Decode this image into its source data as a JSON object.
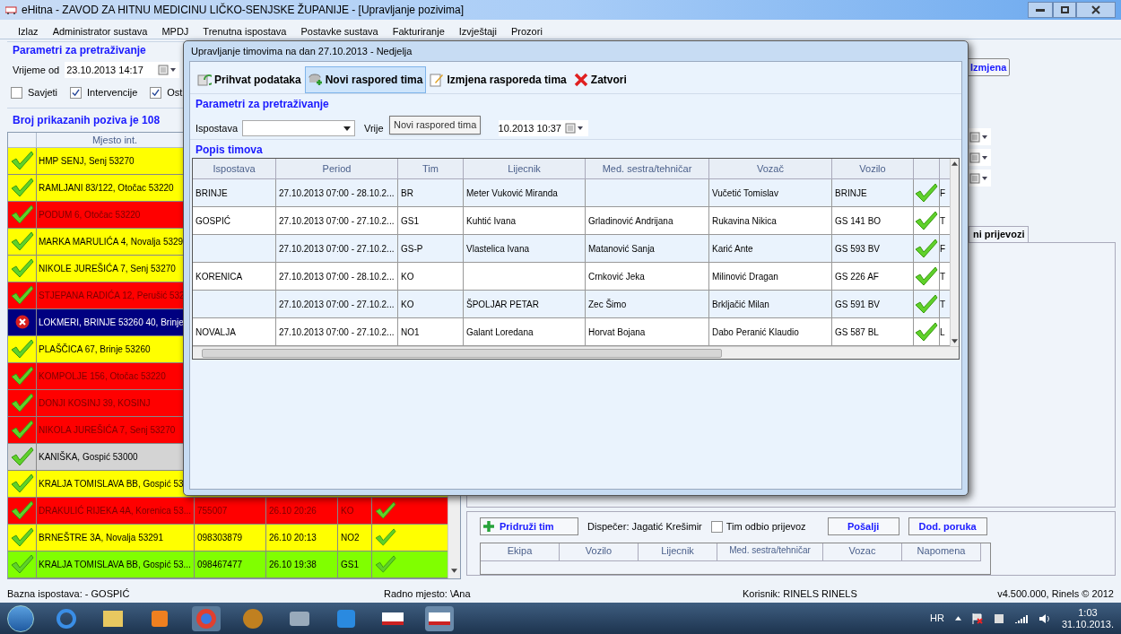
{
  "window": {
    "title": "eHitna - ZAVOD ZA HITNU MEDICINU LIČKO-SENJSKE ŽUPANIJE - [Upravljanje pozivima]"
  },
  "menu": [
    "Izlaz",
    "Administrator sustava",
    "MPDJ",
    "Trenutna ispostava",
    "Postavke sustava",
    "Fakturiranje",
    "Izvještaji",
    "Prozori"
  ],
  "search": {
    "title": "Parametri za pretraživanje",
    "from_label": "Vrijeme od",
    "from_value": "23.10.2013 14:17",
    "filters": [
      {
        "label": "Savjeti",
        "checked": false
      },
      {
        "label": "Intervencije",
        "checked": true
      },
      {
        "label": "Ost",
        "checked": true
      }
    ]
  },
  "calls": {
    "count_text": "Broj prikazanih poziva je 108",
    "columns": [
      "Mjesto int."
    ],
    "rows": [
      {
        "kind": "ok",
        "color": "#ffff00",
        "place": "HMP SENJ, Senj 53270"
      },
      {
        "kind": "ok",
        "color": "#ffff00",
        "place": "RAMLJANI 83/122, Otočac 53220"
      },
      {
        "kind": "ok",
        "color": "#ff0000",
        "place": "PODUM 6, Otočac 53220"
      },
      {
        "kind": "ok",
        "color": "#ffff00",
        "place": "MARKA MARULIĆA 4, Novalja 5329"
      },
      {
        "kind": "ok",
        "color": "#ffff00",
        "place": "NIKOLE JUREŠIĆA 7, Senj 53270"
      },
      {
        "kind": "ok",
        "color": "#ff0000",
        "place": "STJEPANA RADIĆA 12, Perušić 532"
      },
      {
        "kind": "cancelled",
        "color": "#000080",
        "place": "LOKMERI, BRINJE 53260 40, Brinje"
      },
      {
        "kind": "ok",
        "color": "#ffff00",
        "place": "PLAŠČICA 67, Brinje 53260"
      },
      {
        "kind": "ok",
        "color": "#ff0000",
        "place": "KOMPOLJE 156, Otočac 53220"
      },
      {
        "kind": "ok",
        "color": "#ff0000",
        "place": "DONJI KOSINJ 39, KOSINJ"
      },
      {
        "kind": "ok",
        "color": "#ff0000",
        "place": "NIKOLA JUREŠIĆA 7, Senj 53270"
      },
      {
        "kind": "ok",
        "color": "#d4d4d4",
        "place": "KANIŠKA, Gospić 53000"
      },
      {
        "kind": "ok",
        "color": "#ffff00",
        "place": "KRALJA TOMISLAVA BB, Gospić 53"
      },
      {
        "kind": "ok",
        "color": "#ff0000",
        "place": "DRAKULIĆ RIJEKA 4A, Korenica 53...",
        "cells": [
          "755007",
          "26.10 20:26",
          "KO"
        ],
        "confirmed": true
      },
      {
        "kind": "ok",
        "color": "#ffff00",
        "place": "BRNEŠTRE 3A, Novalja 53291",
        "cells": [
          "098303879",
          "26.10 20:13",
          "NO2"
        ],
        "confirmed": true
      },
      {
        "kind": "ok",
        "color": "#80ff00",
        "place": "KRALJA TOMISLAVA BB, Gospić 53...",
        "cells": [
          "098467477",
          "26.10 19:38",
          "GS1"
        ],
        "confirmed": true
      }
    ]
  },
  "right": {
    "edit_button": "Izmjena",
    "tabs": [
      {
        "label": "ni prijevozi",
        "selected": true
      }
    ],
    "join_button": "Pridruži tim",
    "dispatcher": "Dispečer: Jagatić Krešimir",
    "refused": {
      "label": "Tim odbio prijevoz",
      "checked": false
    },
    "send_button": "Pošalji",
    "message_button": "Dod. poruka",
    "columns": [
      "Ekipa",
      "Vozilo",
      "Lijecnik",
      "Med. sestra/tehničar",
      "Vozac",
      "Napomena"
    ]
  },
  "dialog": {
    "title": "Upravljanje timovima na dan 27.10.2013 - Nedjelja",
    "toolbar": [
      {
        "kind": "accept",
        "label": "Prihvat podataka",
        "highlighted": false
      },
      {
        "kind": "new",
        "label": "Novi raspored tima",
        "highlighted": true
      },
      {
        "kind": "edit",
        "label": "Izmjena rasporeda tima",
        "highlighted": false
      },
      {
        "kind": "close",
        "label": "Zatvori",
        "highlighted": false
      }
    ],
    "tooltip": "Novi raspored tima",
    "params_title": "Parametri za pretraživanje",
    "station_label": "Ispostava",
    "time_label": "Vrije",
    "time_value": "10.2013 10:37",
    "teams_title": "Popis timova",
    "columns": [
      "Ispostava",
      "Period",
      "Tim",
      "Lijecnik",
      "Med. sestra/tehničar",
      "Vozač",
      "Vozilo"
    ],
    "rows": [
      {
        "cells": [
          "BRINJE",
          "27.10.2013 07:00 - 28.10.2...",
          "BR",
          "Meter Vuković Miranda",
          "",
          "Vučetić Tomislav",
          "BRINJE"
        ],
        "confirmed": true,
        "column_9": "F"
      },
      {
        "cells": [
          "GOSPIĆ",
          "27.10.2013 07:00 - 27.10.2...",
          "GS1",
          "Kuhtić Ivana",
          "Grladinović Andrijana",
          "Rukavina Nikica",
          "GS 141 BO"
        ],
        "confirmed": true,
        "column_9": "T"
      },
      {
        "cells": [
          "",
          "27.10.2013 07:00 - 27.10.2...",
          "GS-P",
          "Vlastelica Ivana",
          "Matanović Sanja",
          "Karić Ante",
          "GS 593 BV"
        ],
        "confirmed": true,
        "column_9": "F"
      },
      {
        "cells": [
          "KORENICA",
          "27.10.2013 07:00 - 28.10.2...",
          "KO",
          "",
          "Crnković Jeka",
          "Milinović Dragan",
          "GS 226 AF"
        ],
        "confirmed": true,
        "column_9": "T"
      },
      {
        "cells": [
          "",
          "27.10.2013 07:00 - 27.10.2...",
          "KO",
          "ŠPOLJAR PETAR",
          "Zec Šimo",
          "Brkljačić Milan",
          "GS 591 BV"
        ],
        "confirmed": true,
        "column_9": "T"
      },
      {
        "cells": [
          "NOVALJA",
          "27.10.2013 07:00 - 27.10.2...",
          "NO1",
          "Galant Loredana",
          "Horvat Bojana",
          "Dabo Peranić Klaudio",
          "GS 587 BL"
        ],
        "confirmed": true,
        "column_9": "L"
      }
    ]
  },
  "status_bar": [
    "Bazna ispostava:  - GOSPIĆ",
    "Radno mjesto: \\Ana",
    "Korisnik: RINELS RINELS",
    "v4.500.000, Rinels © 2012"
  ],
  "taskbar": {
    "language": "HR",
    "time": "1:03",
    "date": "31.10.2013."
  }
}
